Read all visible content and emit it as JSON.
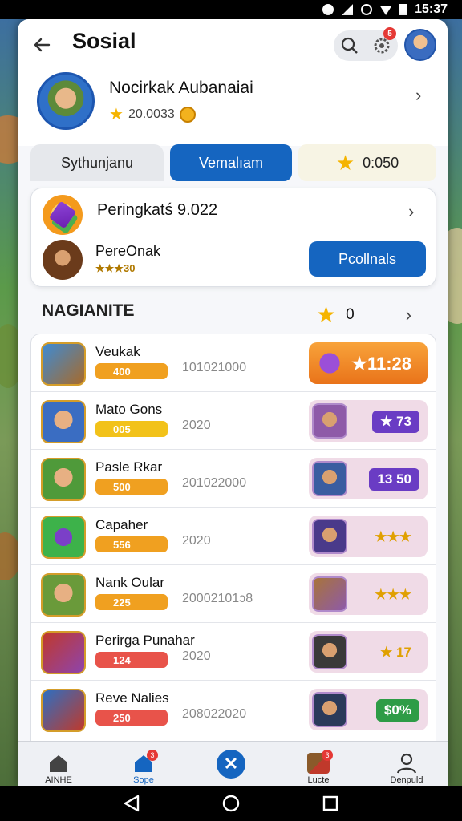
{
  "status_bar": {
    "time": "15:37"
  },
  "header": {
    "title": "Sosial",
    "notification_count": "5"
  },
  "profile": {
    "name": "Nocirkak Aubanaiai",
    "score": "20.0033"
  },
  "tabs": [
    {
      "label": "Sythunjanu"
    },
    {
      "label": "Vemalıam"
    },
    {
      "label": "0:050"
    }
  ],
  "rank_card": {
    "title": "Peringkatś 9.022",
    "player_name": "PereOnak",
    "player_sub": "★★★30",
    "button_label": "Pcollnals"
  },
  "section": {
    "title": "NAGIANITE",
    "count": "0"
  },
  "rows": [
    {
      "name": "Veukak",
      "bar": "400",
      "date": "101021000",
      "value": "★11:28"
    },
    {
      "name": "Mato Gons",
      "bar": "005",
      "date": "2020",
      "value": "★ 73"
    },
    {
      "name": "Pasle Rkar",
      "bar": "500",
      "date": "201022000",
      "value": "13 50"
    },
    {
      "name": "Capaher",
      "bar": "556",
      "date": "2020",
      "value": "★★★"
    },
    {
      "name": "Nank Oular",
      "bar": "225",
      "date": "20002101ↄ8",
      "value": "★★★"
    },
    {
      "name": "Perirga Punahar",
      "bar": "124",
      "date": "2020",
      "value": "★ 17"
    },
    {
      "name": "Reve Nalies",
      "bar": "250",
      "date": "208022020",
      "value": "$0%"
    }
  ],
  "bottom_nav": [
    {
      "label": "AINHE"
    },
    {
      "label": "Sope",
      "badge": "3"
    },
    {
      "label": "Lucte",
      "badge": "3"
    },
    {
      "label": "Denpuld"
    }
  ],
  "colors": {
    "accent": "#1565c0",
    "orange": "#f49a1d",
    "badge": "#e53935"
  }
}
